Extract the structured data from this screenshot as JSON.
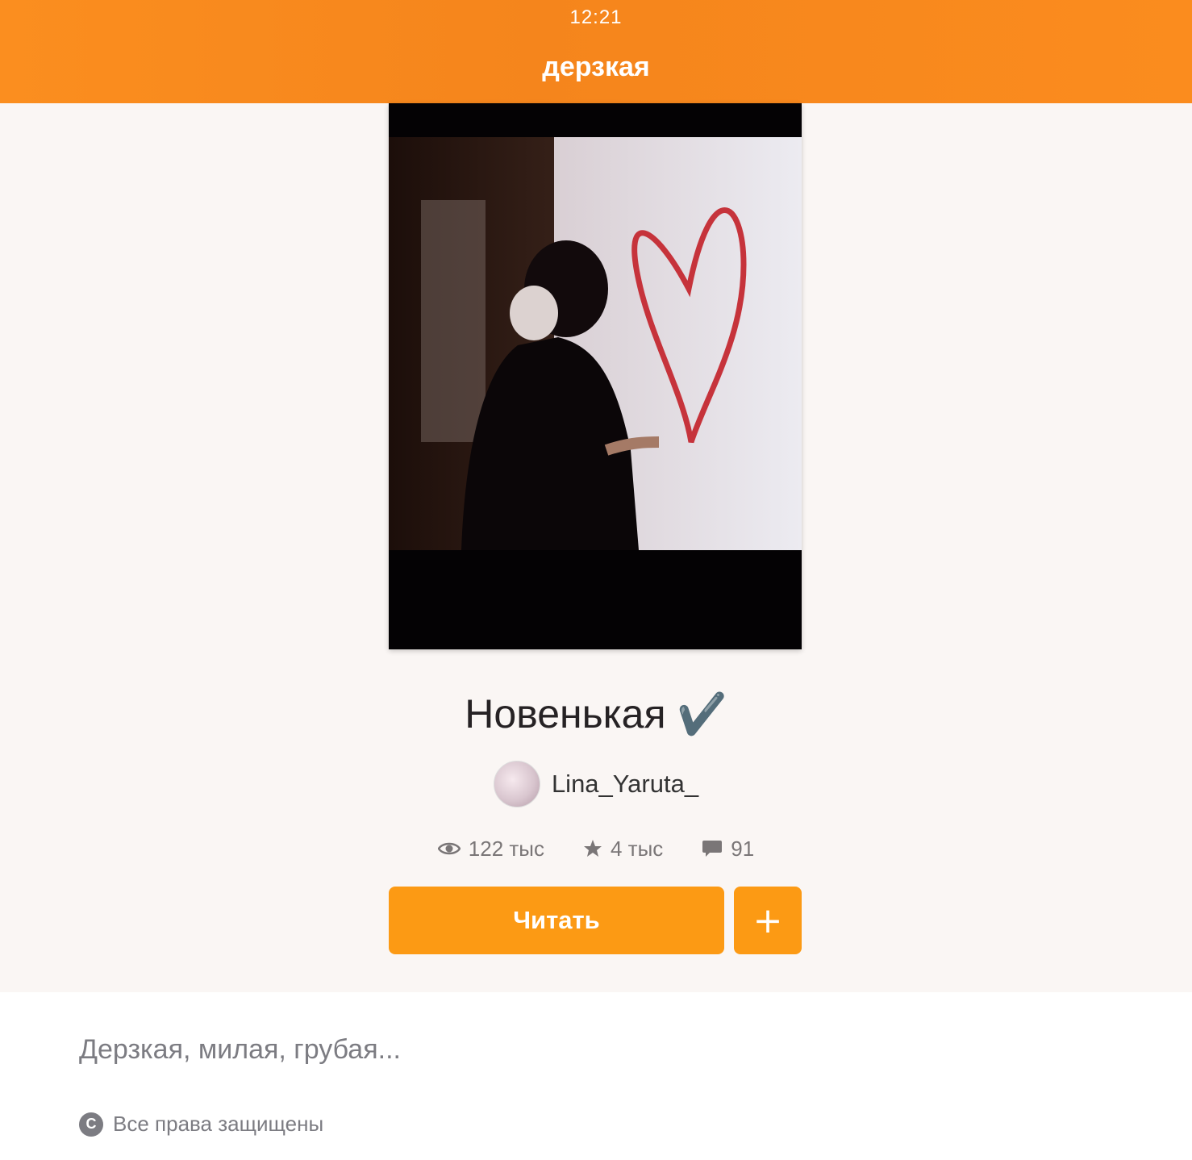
{
  "status_bar": {
    "time": "12:21"
  },
  "header": {
    "title": "дерзкая"
  },
  "book": {
    "title": "Новенькая ✔️",
    "author": "Lina_Yaruta_",
    "stats": {
      "views": "122 тыс",
      "votes": "4 тыс",
      "comments": "91"
    },
    "read_label": "Читать",
    "add_label": "+",
    "description": "Дерзкая, милая, грубая...",
    "copyright": "Все права защищены"
  },
  "icons": {
    "views": "eye-icon",
    "votes": "star-icon",
    "comments": "comment-icon",
    "copyright": "copyright-icon"
  },
  "colors": {
    "header": "#fb8e1f",
    "button": "#fc9a14",
    "background": "#faf6f4"
  }
}
